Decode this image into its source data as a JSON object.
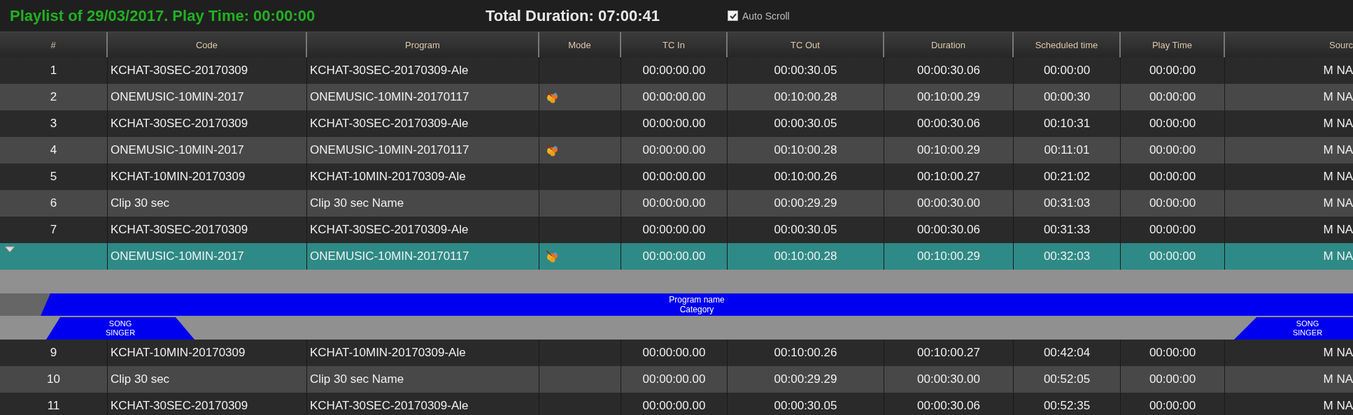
{
  "header": {
    "playlist_title": "Playlist of 29/03/2017. Play Time: 00:00:00",
    "total_duration": "Total Duration: 07:00:41",
    "auto_scroll": {
      "label": "Auto Scroll",
      "checked": true
    }
  },
  "table": {
    "columns": [
      "#",
      "Code",
      "Program",
      "Mode",
      "TC In",
      "TC Out",
      "Duration",
      "Scheduled time",
      "Play Time",
      "Sourc"
    ],
    "rows": [
      {
        "number": "1",
        "code": "KCHAT-30SEC-20170309",
        "program": "KCHAT-30SEC-20170309-Ale",
        "mode_icon": false,
        "tc_in": "00:00:00.00",
        "tc_out": "00:00:30.05",
        "duration": "00:00:30.06",
        "scheduled": "00:00:00",
        "play_time": "00:00:00",
        "source": "M NA",
        "selected": false
      },
      {
        "number": "2",
        "code": "ONEMUSIC-10MIN-2017",
        "program": "ONEMUSIC-10MIN-20170117",
        "mode_icon": true,
        "tc_in": "00:00:00.00",
        "tc_out": "00:10:00.28",
        "duration": "00:10:00.29",
        "scheduled": "00:00:30",
        "play_time": "00:00:00",
        "source": "M NA",
        "selected": false
      },
      {
        "number": "3",
        "code": "KCHAT-30SEC-20170309",
        "program": "KCHAT-30SEC-20170309-Ale",
        "mode_icon": false,
        "tc_in": "00:00:00.00",
        "tc_out": "00:00:30.05",
        "duration": "00:00:30.06",
        "scheduled": "00:10:31",
        "play_time": "00:00:00",
        "source": "M NA",
        "selected": false
      },
      {
        "number": "4",
        "code": "ONEMUSIC-10MIN-2017",
        "program": "ONEMUSIC-10MIN-20170117",
        "mode_icon": true,
        "tc_in": "00:00:00.00",
        "tc_out": "00:10:00.28",
        "duration": "00:10:00.29",
        "scheduled": "00:11:01",
        "play_time": "00:00:00",
        "source": "M NA",
        "selected": false
      },
      {
        "number": "5",
        "code": "KCHAT-10MIN-20170309",
        "program": "KCHAT-10MIN-20170309-Ale",
        "mode_icon": false,
        "tc_in": "00:00:00.00",
        "tc_out": "00:10:00.26",
        "duration": "00:10:00.27",
        "scheduled": "00:21:02",
        "play_time": "00:00:00",
        "source": "M NA",
        "selected": false
      },
      {
        "number": "6",
        "code": "Clip 30 sec",
        "program": "Clip 30 sec Name",
        "mode_icon": false,
        "tc_in": "00:00:00.00",
        "tc_out": "00:00:29.29",
        "duration": "00:00:30.00",
        "scheduled": "00:31:03",
        "play_time": "00:00:00",
        "source": "M NA",
        "selected": false
      },
      {
        "number": "7",
        "code": "KCHAT-30SEC-20170309",
        "program": "KCHAT-30SEC-20170309-Ale",
        "mode_icon": false,
        "tc_in": "00:00:00.00",
        "tc_out": "00:00:30.05",
        "duration": "00:00:30.06",
        "scheduled": "00:31:33",
        "play_time": "00:00:00",
        "source": "M NA",
        "selected": false
      },
      {
        "code": "ONEMUSIC-10MIN-2017",
        "program": "ONEMUSIC-10MIN-20170117",
        "mode_icon": true,
        "tc_in": "00:00:00.00",
        "tc_out": "00:10:00.28",
        "duration": "00:10:00.29",
        "scheduled": "00:32:03",
        "play_time": "00:00:00",
        "source": "M NA",
        "selected": true,
        "timeline": {
          "program": {
            "title": "Program name",
            "subtitle": "Category"
          },
          "songs": [
            {
              "title": "SONG",
              "subtitle": "SINGER"
            },
            {
              "title": "SONG",
              "subtitle": "SINGER"
            }
          ]
        }
      },
      {
        "number": "9",
        "code": "KCHAT-10MIN-20170309",
        "program": "KCHAT-10MIN-20170309-Ale",
        "mode_icon": false,
        "tc_in": "00:00:00.00",
        "tc_out": "00:10:00.26",
        "duration": "00:10:00.27",
        "scheduled": "00:42:04",
        "play_time": "00:00:00",
        "source": "M NA",
        "selected": false
      },
      {
        "number": "10",
        "code": "Clip 30 sec",
        "program": "Clip 30 sec Name",
        "mode_icon": false,
        "tc_in": "00:00:00.00",
        "tc_out": "00:00:29.29",
        "duration": "00:00:30.00",
        "scheduled": "00:52:05",
        "play_time": "00:00:00",
        "source": "M NA",
        "selected": false
      },
      {
        "number": "11",
        "code": "KCHAT-30SEC-20170309",
        "program": "KCHAT-30SEC-20170309-Ale",
        "mode_icon": false,
        "tc_in": "00:00:00.00",
        "tc_out": "00:00:30.05",
        "duration": "00:00:30.06",
        "scheduled": "00:52:35",
        "play_time": "00:00:00",
        "source": "M NA",
        "selected": false
      }
    ]
  }
}
